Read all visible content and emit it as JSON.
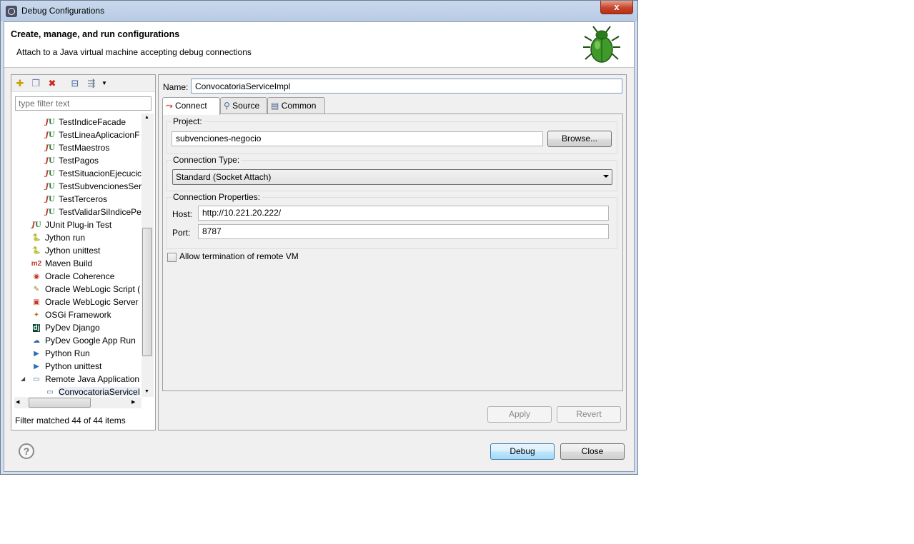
{
  "window": {
    "title": "Debug Configurations",
    "close_glyph": "x"
  },
  "header": {
    "title": "Create, manage, and run configurations",
    "description": "Attach to a Java virtual machine accepting debug connections",
    "icon": "bug-icon"
  },
  "left_panel": {
    "toolbar": [
      "new-configuration-icon",
      "duplicate-icon",
      "delete-icon",
      "collapse-all-icon",
      "filter-icon",
      "dropdown-icon"
    ],
    "filter_placeholder": "type filter text",
    "tree": [
      {
        "label": "TestIndiceFacade",
        "icon": "junit-icon",
        "level": 2
      },
      {
        "label": "TestLineaAplicacionF",
        "icon": "junit-icon",
        "level": 2
      },
      {
        "label": "TestMaestros",
        "icon": "junit-icon",
        "level": 2
      },
      {
        "label": "TestPagos",
        "icon": "junit-icon",
        "level": 2
      },
      {
        "label": "TestSituacionEjecucic",
        "icon": "junit-icon",
        "level": 2
      },
      {
        "label": "TestSubvencionesSer",
        "icon": "junit-icon",
        "level": 2
      },
      {
        "label": "TestTerceros",
        "icon": "junit-icon",
        "level": 2
      },
      {
        "label": "TestValidarSiIndicePe",
        "icon": "junit-icon",
        "level": 2
      },
      {
        "label": "JUnit Plug-in Test",
        "icon": "junit-plugin-icon",
        "level": 1
      },
      {
        "label": "Jython run",
        "icon": "jython-icon",
        "level": 1
      },
      {
        "label": "Jython unittest",
        "icon": "jython-unittest-icon",
        "level": 1
      },
      {
        "label": "Maven Build",
        "icon": "maven-icon",
        "level": 1
      },
      {
        "label": "Oracle Coherence",
        "icon": "oracle-coherence-icon",
        "level": 1
      },
      {
        "label": "Oracle WebLogic Script (",
        "icon": "weblogic-script-icon",
        "level": 1
      },
      {
        "label": "Oracle WebLogic Server",
        "icon": "weblogic-server-icon",
        "level": 1
      },
      {
        "label": "OSGi Framework",
        "icon": "osgi-icon",
        "level": 1
      },
      {
        "label": "PyDev Django",
        "icon": "django-icon",
        "level": 1
      },
      {
        "label": "PyDev Google App Run",
        "icon": "google-app-icon",
        "level": 1
      },
      {
        "label": "Python Run",
        "icon": "python-icon",
        "level": 1
      },
      {
        "label": "Python unittest",
        "icon": "python-unittest-icon",
        "level": 1
      },
      {
        "label": "Remote Java Application",
        "icon": "remote-java-icon",
        "level": 1,
        "expanded": true
      },
      {
        "label": "ConvocatoriaServiceI",
        "icon": "remote-config-icon",
        "level": 2,
        "selected": true
      }
    ],
    "status": "Filter matched 44 of 44 items"
  },
  "config": {
    "name_label": "Name:",
    "name_value": "ConvocatoriaServiceImpl",
    "tabs": [
      {
        "label": "Connect",
        "icon": "connect-icon",
        "active": true
      },
      {
        "label": "Source",
        "icon": "source-icon"
      },
      {
        "label": "Common",
        "icon": "common-icon"
      }
    ],
    "project_label": "Project:",
    "project_value": "subvenciones-negocio",
    "browse_label": "Browse...",
    "connection_type_label": "Connection Type:",
    "connection_type_value": "Standard (Socket Attach)",
    "connection_props_label": "Connection Properties:",
    "host_label": "Host:",
    "host_value": "http://10.221.20.222/",
    "port_label": "Port:",
    "port_value": "8787",
    "allow_termination_label": "Allow termination of remote VM",
    "allow_termination_checked": false,
    "apply_label": "Apply",
    "revert_label": "Revert"
  },
  "footer": {
    "help_glyph": "?",
    "debug_label": "Debug",
    "close_label": "Close"
  }
}
